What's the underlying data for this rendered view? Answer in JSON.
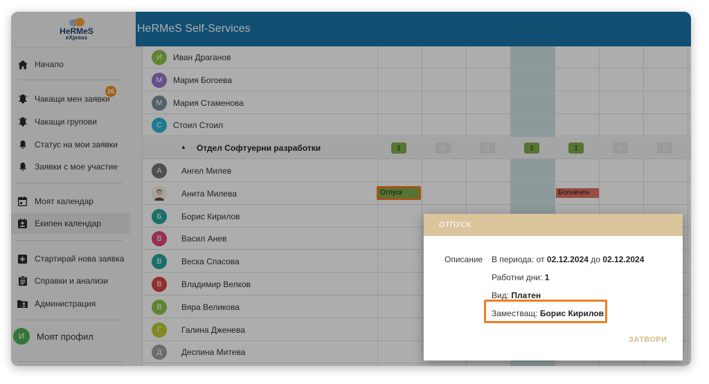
{
  "app": {
    "logo_main": "HeRMeS",
    "logo_sub": "eXpress",
    "title": "HeRMeS Self-Services"
  },
  "sidebar": {
    "items": [
      {
        "label": "Начало",
        "icon": "home-icon"
      },
      {
        "label": "Чакащи мен заявки",
        "icon": "bell-ring-icon",
        "badge": "26"
      },
      {
        "label": "Чакащи групови",
        "icon": "bell-ring-icon"
      },
      {
        "label": "Статус на мои заявки",
        "icon": "bell-icon"
      },
      {
        "label": "Заявки с мое участие",
        "icon": "bell-icon"
      },
      {
        "label": "Моят календар",
        "icon": "calendar-icon"
      },
      {
        "label": "Екипен календар",
        "icon": "team-calendar-icon"
      },
      {
        "label": "Стартирай нова заявка",
        "icon": "plus-box-icon"
      },
      {
        "label": "Справки и анализи",
        "icon": "report-icon"
      },
      {
        "label": "Администрация",
        "icon": "folder-person-icon"
      }
    ],
    "profile": {
      "initial": "И",
      "label": "Моят профил"
    }
  },
  "calendar": {
    "top_people": [
      {
        "initial": "И",
        "name": "Иван Драганов",
        "color": "#8bc34a"
      },
      {
        "initial": "М",
        "name": "Мария Богоева",
        "color": "#9575cd"
      },
      {
        "initial": "М",
        "name": "Мария Стаменова",
        "color": "#78909c"
      },
      {
        "initial": "С",
        "name": "Стоил Стоил",
        "color": "#29b6d8"
      }
    ],
    "group": {
      "toggle": "▲",
      "name": "Отдел Софтуерни разработки",
      "counts": [
        "1",
        "0",
        "0",
        "1",
        "1",
        "0",
        "0"
      ]
    },
    "members": [
      {
        "initial": "А",
        "name": "Ангел Милев",
        "color": "#757575"
      },
      {
        "initial": "",
        "name": "Анита Милева",
        "color": "#c8a27c",
        "photo": true
      },
      {
        "initial": "Б",
        "name": "Борис Кирилов",
        "color": "#26a69a"
      },
      {
        "initial": "В",
        "name": "Васил Анев",
        "color": "#e0457b"
      },
      {
        "initial": "В",
        "name": "Веска Спасова",
        "color": "#26a69a"
      },
      {
        "initial": "В",
        "name": "Владимир Велков",
        "color": "#d84343"
      },
      {
        "initial": "В",
        "name": "Вяра Великова",
        "color": "#8bc34a"
      },
      {
        "initial": "Г",
        "name": "Галина Дженева",
        "color": "#c0ca33"
      },
      {
        "initial": "Д",
        "name": "Деспина Митева",
        "color": "#9e9e9e"
      }
    ],
    "events": [
      {
        "label": "Отпуск",
        "color": "#7fac4a"
      },
      {
        "label": "Болничен",
        "color": "#e07060"
      }
    ]
  },
  "dialog": {
    "title": "ОТПУСК",
    "description_label": "Описание",
    "period_prefix": "В периода: от",
    "period_from": "02.12.2024",
    "period_mid": "до",
    "period_to": "02.12.2024",
    "workdays_label": "Работни дни:",
    "workdays_value": "1",
    "type_label": "Вид:",
    "type_value": "Платен",
    "deputy_label": "Заместващ:",
    "deputy_value": "Борис Кирилов",
    "close_label": "ЗАТВОРИ"
  },
  "colors": {
    "header": "#1a73a9",
    "highlight": "#f07d1f",
    "dialog_head": "#d9c49c",
    "badge": "#f08a17"
  }
}
